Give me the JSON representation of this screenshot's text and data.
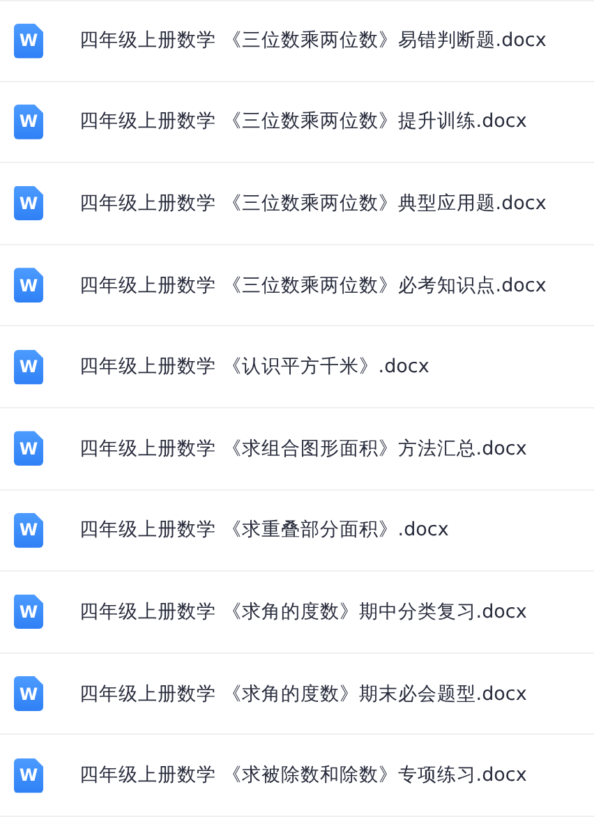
{
  "files": [
    {
      "icon_label": "W",
      "name": "四年级上册数学 《三位数乘两位数》易错判断题.docx"
    },
    {
      "icon_label": "W",
      "name": "四年级上册数学 《三位数乘两位数》提升训练.docx"
    },
    {
      "icon_label": "W",
      "name": "四年级上册数学 《三位数乘两位数》典型应用题.docx"
    },
    {
      "icon_label": "W",
      "name": "四年级上册数学 《三位数乘两位数》必考知识点.docx"
    },
    {
      "icon_label": "W",
      "name": "四年级上册数学 《认识平方千米》.docx"
    },
    {
      "icon_label": "W",
      "name": "四年级上册数学 《求组合图形面积》方法汇总.docx"
    },
    {
      "icon_label": "W",
      "name": "四年级上册数学 《求重叠部分面积》.docx"
    },
    {
      "icon_label": "W",
      "name": "四年级上册数学 《求角的度数》期中分类复习.docx"
    },
    {
      "icon_label": "W",
      "name": "四年级上册数学 《求角的度数》期末必会题型.docx"
    },
    {
      "icon_label": "W",
      "name": "四年级上册数学 《求被除数和除数》专项练习.docx"
    }
  ]
}
